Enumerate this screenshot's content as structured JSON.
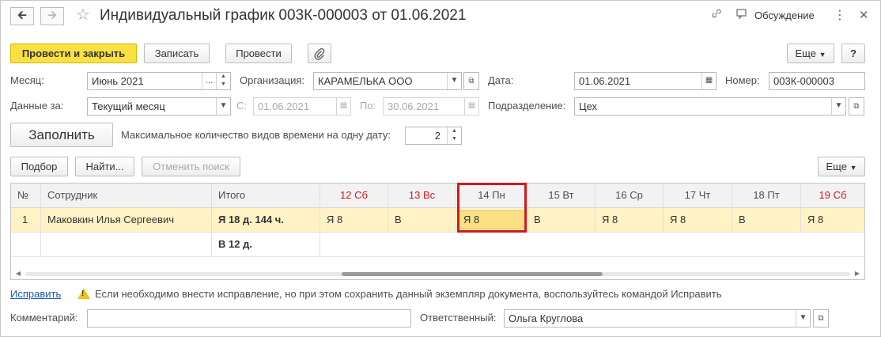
{
  "header": {
    "back_icon": "arrow-left-icon",
    "forward_icon": "arrow-right-icon",
    "favorite_icon": "star-icon",
    "title": "Индивидуальный график 003К-000003 от 01.06.2021",
    "discuss_label": "Обсуждение",
    "menu_icon": "more-vertical-icon",
    "close_icon": "close-icon"
  },
  "toolbar": {
    "post_close": "Провести и закрыть",
    "save": "Записать",
    "post": "Провести",
    "more": "Еще",
    "help": "?"
  },
  "form": {
    "month_label": "Месяц:",
    "month_value": "Июнь 2021",
    "org_label": "Организация:",
    "org_value": "КАРАМЕЛЬКА ООО",
    "date_label": "Дата:",
    "date_value": "01.06.2021",
    "number_label": "Номер:",
    "number_value": "003К-000003",
    "data_for_label": "Данные за:",
    "data_for_value": "Текущий месяц",
    "from_label": "С:",
    "from_value": "01.06.2021",
    "to_label": "По:",
    "to_value": "30.06.2021",
    "division_label": "Подразделение:",
    "division_value": "Цех",
    "fill_button": "Заполнить",
    "max_types_label": "Максимальное количество видов времени на одну дату:",
    "max_types_value": "2"
  },
  "table_toolbar": {
    "pick": "Подбор",
    "find": "Найти...",
    "cancel_search": "Отменить поиск",
    "more": "Еще"
  },
  "table": {
    "columns": [
      "№",
      "Сотрудник",
      "Итого",
      "12 Сб",
      "13 Вс",
      "14 Пн",
      "15 Вт",
      "16 Ср",
      "17 Чт",
      "18 Пт",
      "19 Сб"
    ],
    "row1": [
      "1",
      "Маковкин Илья Сергеевич",
      "Я 18 д. 144 ч.",
      "Я 8",
      "В",
      "Я 8",
      "В",
      "Я 8",
      "Я 8",
      "В",
      "Я 8"
    ],
    "row2_total": "В 12 д."
  },
  "footer": {
    "fix_link": "Исправить",
    "warning_text": "Если необходимо внести исправление, но при этом сохранить данный экземпляр документа, воспользуйтесь командой Исправить",
    "comment_label": "Комментарий:",
    "comment_value": "",
    "responsible_label": "Ответственный:",
    "responsible_value": "Ольга Круглова"
  },
  "colors": {
    "primary_button": "#f9e043",
    "selected_row": "#fff3c6",
    "selected_cell": "#fbe183",
    "weekend_header": "#d01a1a",
    "highlight_box": "#d6171c",
    "link": "#1a56b8"
  }
}
